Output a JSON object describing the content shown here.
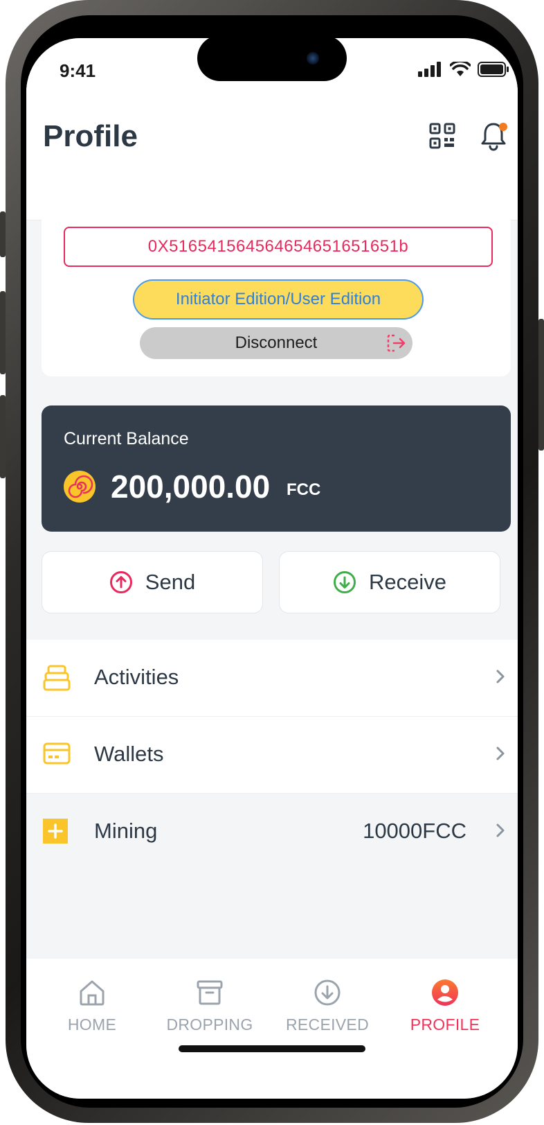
{
  "status_bar": {
    "time": "9:41"
  },
  "header": {
    "title": "Profile"
  },
  "account": {
    "address": "0X516541564564654651651651b",
    "edition_label": "Initiator Edition/User Edition",
    "disconnect_label": "Disconnect"
  },
  "balance": {
    "label": "Current Balance",
    "amount": "200,000.00",
    "unit": "FCC"
  },
  "actions": {
    "send_label": "Send",
    "receive_label": "Receive"
  },
  "menu": {
    "items": [
      {
        "label": "Activities",
        "icon": "box-stack-icon"
      },
      {
        "label": "Wallets",
        "icon": "card-icon"
      },
      {
        "label": "Mining",
        "icon": "plus-square-icon",
        "value": "10000FCC"
      }
    ]
  },
  "tabs": [
    {
      "label": "HOME",
      "icon": "home-icon"
    },
    {
      "label": "DROPPING",
      "icon": "archive-icon"
    },
    {
      "label": "RECEIVED",
      "icon": "download-circle-icon"
    },
    {
      "label": "PROFILE",
      "icon": "user-circle-icon",
      "active": true
    }
  ],
  "colors": {
    "accent_red": "#e9285c",
    "edition_yellow": "#fddc5c",
    "edition_blue": "#2f7fd9",
    "balance_card": "#333e4a",
    "icon_yellow": "#f9c52b",
    "receive_green": "#3fae49",
    "tab_inactive": "#9ba3ad",
    "tab_active": "#f0325b"
  }
}
